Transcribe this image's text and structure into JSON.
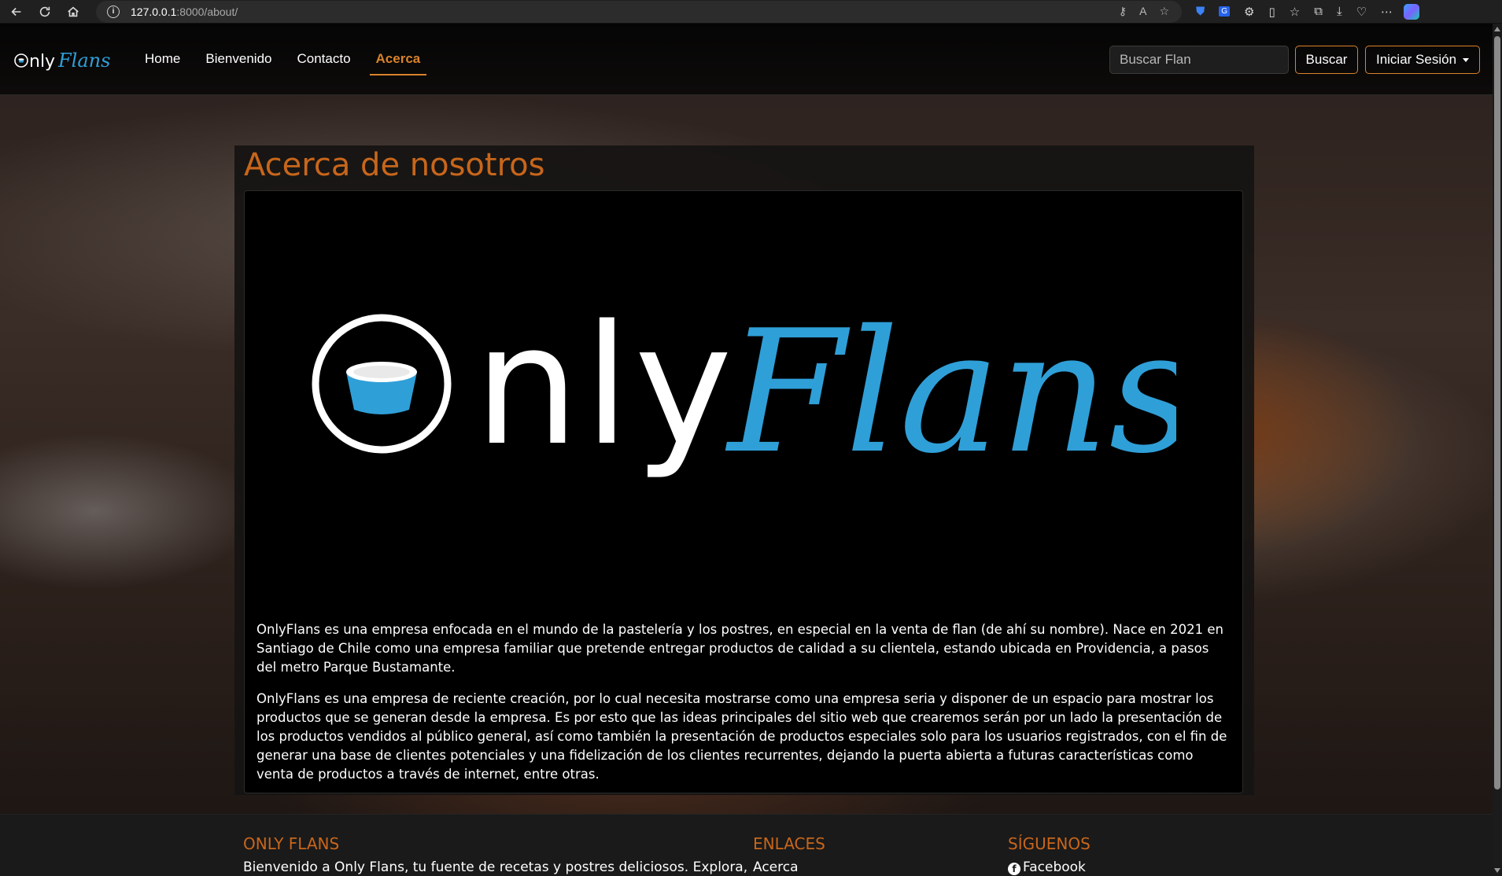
{
  "browser": {
    "url_host": "127.0.0.1",
    "url_path": ":8000/about/"
  },
  "navbar": {
    "links": [
      {
        "label": "Home"
      },
      {
        "label": "Bienvenido"
      },
      {
        "label": "Contacto"
      },
      {
        "label": "Acerca",
        "active": true
      }
    ],
    "search_placeholder": "Buscar Flan",
    "search_button": "Buscar",
    "login_button": "Iniciar Sesión"
  },
  "main": {
    "title": "Acerca de nosotros",
    "paragraphs": [
      "OnlyFlans es una empresa enfocada en el mundo de la pastelería y los postres, en especial en la venta de flan (de ahí su nombre). Nace en 2021 en Santiago de Chile como una empresa familiar que pretende entregar productos de calidad a su clientela, estando ubicada en Providencia, a pasos del metro Parque Bustamante.",
      "OnlyFlans es una empresa de reciente creación, por lo cual necesita mostrarse como una empresa seria y disponer de un espacio para mostrar los productos que se generan desde la empresa. Es por esto que las ideas principales del sitio web que crearemos serán por un lado la presentación de los productos vendidos al público general, así como también la presentación de productos especiales solo para los usuarios registrados, con el fin de generar una base de clientes potenciales y una fidelización de los clientes recurrentes, dejando la puerta abierta a futuras características como venta de productos a través de internet, entre otras."
    ]
  },
  "logo": {
    "text_only": "nly",
    "text_flans": "Flans"
  },
  "footer": {
    "col1_title": "ONLY FLANS",
    "col1_text": "Bienvenido a Only Flans, tu fuente de recetas y postres deliciosos. Explora,",
    "col2_title": "ENLACES",
    "col2_link": "Acerca",
    "col3_title": "SÍGUENOS",
    "col3_link": "Facebook"
  },
  "colors": {
    "accent": "#c8661b",
    "logo_blue": "#2f9fd8"
  }
}
